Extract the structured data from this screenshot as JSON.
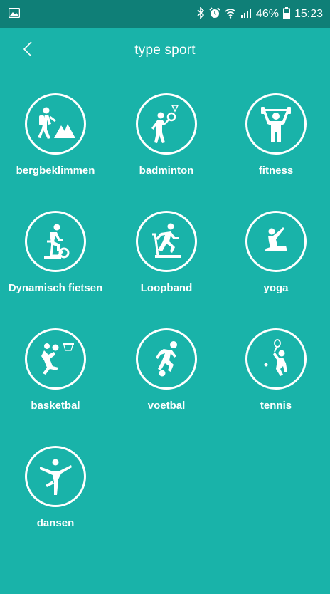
{
  "status": {
    "battery": "46%",
    "time": "15:23",
    "icons": [
      "image-icon",
      "bluetooth-icon",
      "alarm-icon",
      "wifi-icon",
      "signal-icon",
      "battery-icon"
    ]
  },
  "header": {
    "title": "type sport",
    "back_icon": "chevron-left-icon"
  },
  "sports": [
    {
      "label": "bergbeklimmen",
      "icon": "mountain-climbing-icon"
    },
    {
      "label": "badminton",
      "icon": "badminton-icon"
    },
    {
      "label": "fitness",
      "icon": "dumbbell-icon"
    },
    {
      "label": "Dynamisch fietsen",
      "icon": "spinning-bike-icon"
    },
    {
      "label": "Loopband",
      "icon": "treadmill-icon"
    },
    {
      "label": "yoga",
      "icon": "yoga-icon"
    },
    {
      "label": "basketbal",
      "icon": "basketball-icon"
    },
    {
      "label": "voetbal",
      "icon": "football-icon"
    },
    {
      "label": "tennis",
      "icon": "tennis-icon"
    },
    {
      "label": "dansen",
      "icon": "dance-icon"
    }
  ],
  "colors": {
    "background": "#19b3a9",
    "statusbar": "#0f7f77",
    "foreground": "#ffffff"
  }
}
